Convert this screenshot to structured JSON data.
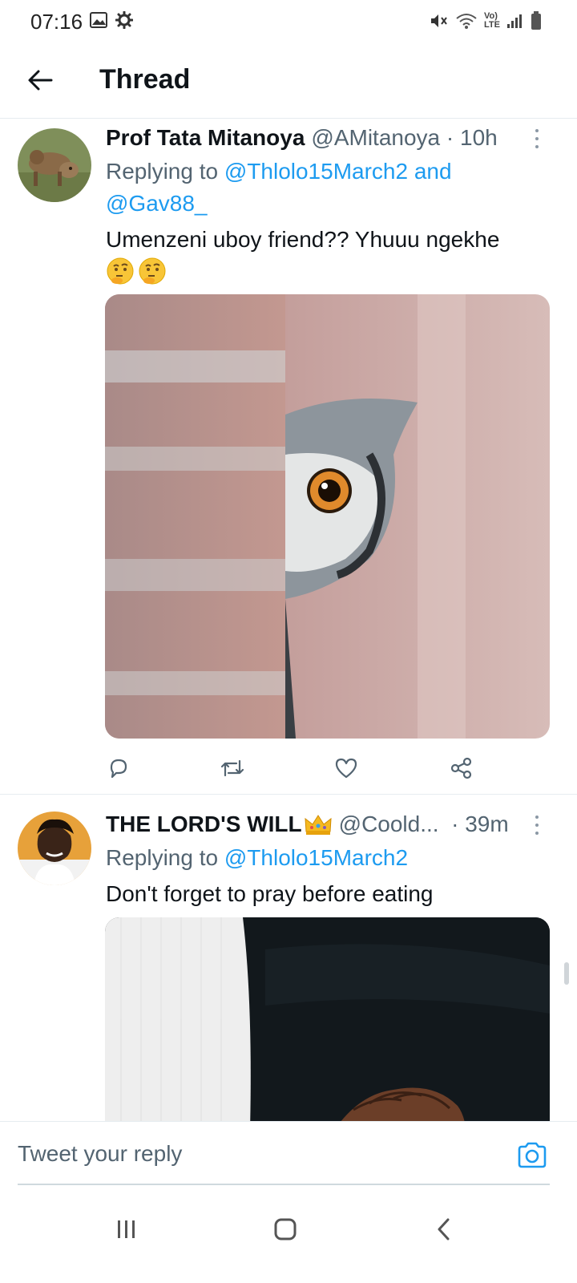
{
  "status_bar": {
    "time": "07:16",
    "left_icons": [
      "gallery-icon",
      "gear-icon"
    ],
    "right_icons": [
      "mute-icon",
      "wifi-icon",
      "volte-icon",
      "signal-icon",
      "battery-icon"
    ],
    "volte_line1": "Vo)",
    "volte_line2": "LTE"
  },
  "header": {
    "title": "Thread",
    "back_icon": "arrow-left-icon"
  },
  "tweets": [
    {
      "name": "Prof Tata Mitanoya",
      "handle": "@AMitanoya",
      "time": "· 10h",
      "replying_prefix": "Replying to ",
      "replying_mention_1": "@Thlolo15March2",
      "replying_and": " and",
      "replying_mention_2": "@Gav88_",
      "text": "Umenzeni uboy friend?? Yhuuu ngekhe",
      "emojis": [
        "thinking-face-emoji",
        "thinking-face-emoji"
      ],
      "media": "owl-peeking-behind-brick-wall-photo"
    },
    {
      "name": "THE LORD'S WILL",
      "name_emoji": "crown-emoji",
      "handle": "@Coold...",
      "time": "· 39m",
      "replying_prefix": "Replying to ",
      "replying_mention_1": "@Thlolo15March2",
      "text": "Don't forget to pray before eating",
      "media": "praying-hands-photo"
    }
  ],
  "actions": [
    "reply-icon",
    "retweet-icon",
    "like-icon",
    "share-icon"
  ],
  "reply_bar": {
    "placeholder": "Tweet your reply",
    "camera_icon": "camera-icon"
  },
  "nav_bar": [
    "recents-icon",
    "home-icon",
    "back-icon"
  ],
  "colors": {
    "accent": "#1d9bf0",
    "text": "#0f1419",
    "secondary": "#536471",
    "divider": "#e6ecf0"
  }
}
